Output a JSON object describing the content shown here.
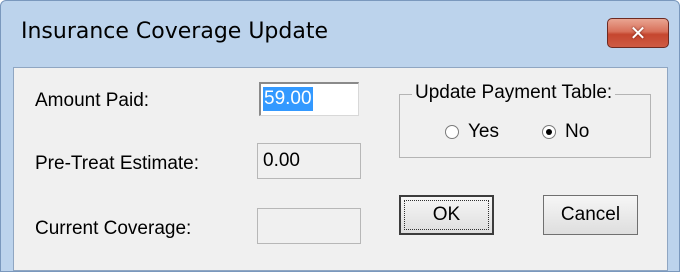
{
  "window": {
    "title": "Insurance Coverage Update",
    "close_label": "✕"
  },
  "form": {
    "amount_paid": {
      "label": "Amount Paid:",
      "value": "59.00"
    },
    "pre_treat_estimate": {
      "label": "Pre-Treat Estimate:",
      "value": "0.00"
    },
    "current_coverage": {
      "label": "Current Coverage:",
      "value": ""
    }
  },
  "update_payment_table": {
    "label": "Update Payment Table:",
    "options": [
      {
        "label": "Yes",
        "checked": false
      },
      {
        "label": "No",
        "checked": true
      }
    ]
  },
  "buttons": {
    "ok": "OK",
    "cancel": "Cancel"
  }
}
